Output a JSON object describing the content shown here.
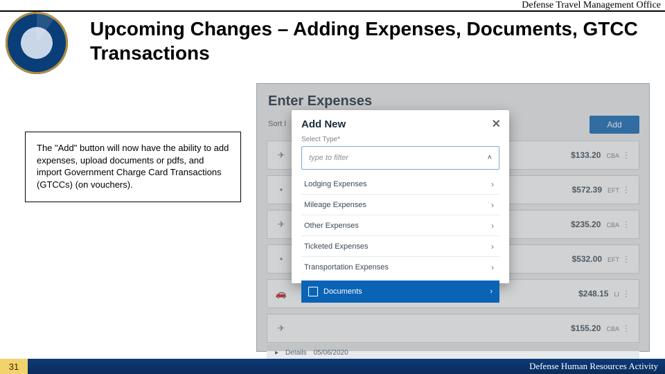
{
  "header": {
    "office_label": "Defense Travel Management Office",
    "title": "Upcoming Changes – Adding Expenses, Documents, GTCC Transactions"
  },
  "note": {
    "text": "The \"Add\" button will now have the ability to add expenses, upload documents or pdfs, and import Government Charge Card Transactions (GTCCs) (on vouchers)."
  },
  "screenshot": {
    "title": "Enter Expenses",
    "sort_label": "Sort I",
    "add_button": "Add",
    "rows": [
      {
        "icon": "plane",
        "amount": "$133.20",
        "tag": "CBA"
      },
      {
        "icon": "dot",
        "amount": "$572.39",
        "tag": "EFT"
      },
      {
        "icon": "plane",
        "amount": "$235.20",
        "tag": "CBA"
      },
      {
        "icon": "dot",
        "amount": "$532.00",
        "tag": "EFT"
      },
      {
        "icon": "car",
        "amount": "$248.15",
        "tag": "LI"
      },
      {
        "icon": "plane",
        "amount": "$155.20",
        "tag": "CBA"
      }
    ],
    "details_label": "Details",
    "details_date": "05/06/2020"
  },
  "modal": {
    "title": "Add New",
    "label": "Select Type*",
    "placeholder": "type to filter",
    "options": [
      "Lodging Expenses",
      "Mileage Expenses",
      "Other Expenses",
      "Ticketed Expenses",
      "Transportation Expenses"
    ],
    "documents_label": "Documents"
  },
  "footer": {
    "page_number": "31",
    "agency": "Defense Human Resources Activity"
  }
}
